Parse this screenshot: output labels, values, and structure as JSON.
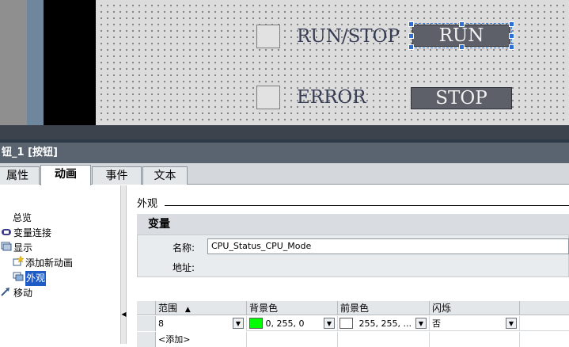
{
  "canvas": {
    "status_rows": [
      {
        "label": "RUN/STOP",
        "button": "RUN"
      },
      {
        "label": "ERROR",
        "button": "STOP"
      }
    ]
  },
  "window": {
    "title": "钮_1 [按钮]"
  },
  "tabs": [
    {
      "label": "属性",
      "active": false
    },
    {
      "label": "动画",
      "active": true
    },
    {
      "label": "事件",
      "active": false
    },
    {
      "label": "文本",
      "active": false
    }
  ],
  "tree": {
    "items": [
      {
        "label": "总览",
        "icon": "none"
      },
      {
        "label": "变量连接",
        "icon": "tag-link-icon"
      },
      {
        "label": "显示",
        "icon": "display-icon"
      },
      {
        "label": "添加新动画",
        "icon": "add-star-icon"
      },
      {
        "label": "外观",
        "icon": "appearance-icon",
        "selected": true
      },
      {
        "label": "移动",
        "icon": "move-icon"
      }
    ]
  },
  "appearance": {
    "section_title": "外观",
    "variable_group": {
      "title": "变量",
      "name_label": "名称:",
      "name_value": "CPU_Status_CPU_Mode",
      "address_label": "地址:"
    },
    "table": {
      "columns": [
        "范围",
        "背景色",
        "前景色",
        "闪烁"
      ],
      "sort_indicator": "▲",
      "rows": [
        {
          "range": "8",
          "bg_text": "0, 255, 0",
          "fg_text": "255, 255, ...",
          "flash": "否"
        }
      ],
      "add_row": "<添加>"
    }
  },
  "colors": {
    "bg_swatch": "#00ff00",
    "fg_swatch": "#ffffff",
    "selection": "#1e5bc6",
    "title_bar": "#5a6470"
  }
}
